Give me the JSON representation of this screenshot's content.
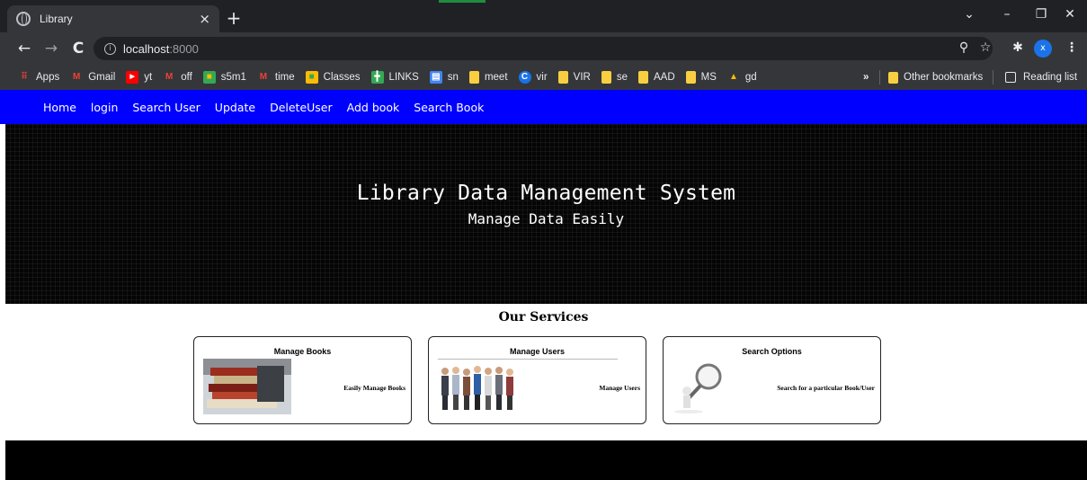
{
  "browser": {
    "tab_title": "Library",
    "tab_close": "×",
    "new_tab": "+",
    "url_host": "localhost",
    "url_port": ":8000",
    "bookmarks": [
      {
        "label": "Apps",
        "icon": "apps-grid-icon",
        "color": "#ea4335"
      },
      {
        "label": "Gmail",
        "icon": "gmail-icon",
        "color": "#ea4335"
      },
      {
        "label": "yt",
        "icon": "youtube-icon",
        "color": "#ff0000"
      },
      {
        "label": "off",
        "icon": "gmail-icon",
        "color": "#ea4335"
      },
      {
        "label": "s5m1",
        "icon": "classroom-icon",
        "color": "#34a853"
      },
      {
        "label": "time",
        "icon": "gmail-icon",
        "color": "#ea4335"
      },
      {
        "label": "Classes",
        "icon": "classroom-icon",
        "color": "#fbbc04"
      },
      {
        "label": "LINKS",
        "icon": "sheets-icon",
        "color": "#34a853"
      },
      {
        "label": "sn",
        "icon": "docs-icon",
        "color": "#4285f4"
      },
      {
        "label": "meet",
        "icon": "folder-icon",
        "color": "#f9cf41"
      },
      {
        "label": "vir",
        "icon": "c-icon",
        "color": "#1a73e8"
      },
      {
        "label": "VIR",
        "icon": "folder-icon",
        "color": "#f9cf41"
      },
      {
        "label": "se",
        "icon": "folder-icon",
        "color": "#f9cf41"
      },
      {
        "label": "AAD",
        "icon": "folder-icon",
        "color": "#f9cf41"
      },
      {
        "label": "MS",
        "icon": "folder-icon",
        "color": "#f9cf41"
      },
      {
        "label": "gd",
        "icon": "drive-icon",
        "color": "#34a853"
      }
    ],
    "more_bookmarks": "»",
    "other_bookmarks": "Other bookmarks",
    "reading_list": "Reading list",
    "profile_initial": "x"
  },
  "nav": {
    "items": [
      {
        "label": "Home"
      },
      {
        "label": "login"
      },
      {
        "label": "Search User"
      },
      {
        "label": "Update"
      },
      {
        "label": "DeleteUser"
      },
      {
        "label": "Add book"
      },
      {
        "label": "Search Book"
      }
    ],
    "background": "#0000ff"
  },
  "hero": {
    "title": "Library Data Management System",
    "subtitle": "Manage Data Easily"
  },
  "services": {
    "heading": "Our Services",
    "cards": [
      {
        "title": "Manage Books",
        "description": "Easily Manage Books",
        "image": "book-stack-image"
      },
      {
        "title": "Manage Users",
        "description": "Manage Users",
        "image": "people-group-image"
      },
      {
        "title": "Search Options",
        "description": "Search for a particular Book/User",
        "image": "magnifier-figure-image"
      }
    ]
  }
}
